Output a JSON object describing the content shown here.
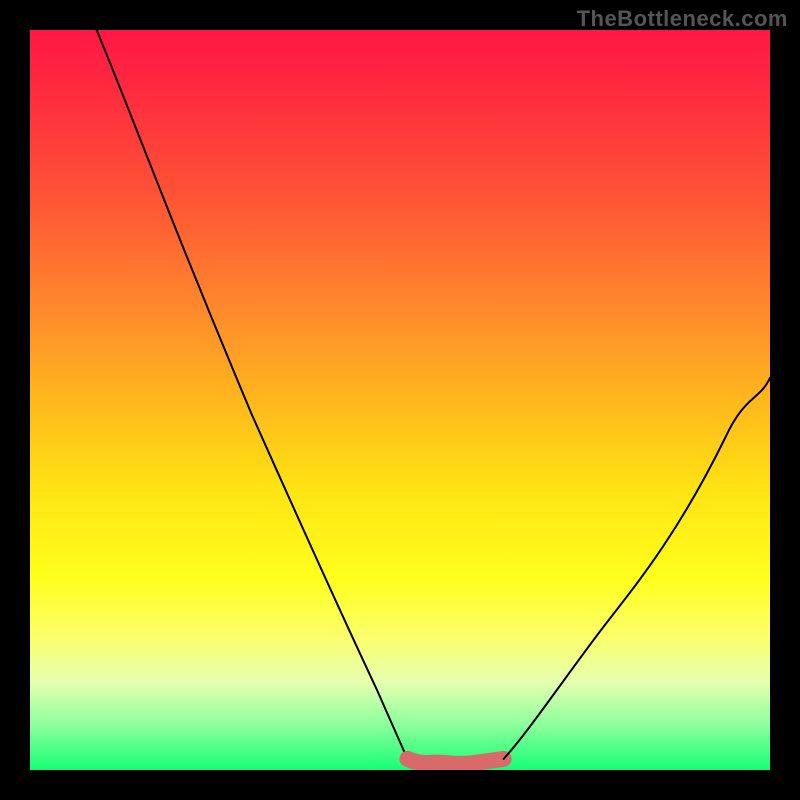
{
  "watermark": "TheBottleneck.com",
  "chart_data": {
    "type": "line",
    "title": "",
    "xlabel": "",
    "ylabel": "",
    "xlim": [
      0,
      100
    ],
    "ylim": [
      0,
      100
    ],
    "grid": false,
    "legend": false,
    "background_gradient": {
      "direction": "top-to-bottom",
      "stops": [
        {
          "pos": 0,
          "color": "#ff1745"
        },
        {
          "pos": 23,
          "color": "#ff5535"
        },
        {
          "pos": 50,
          "color": "#ffb71c"
        },
        {
          "pos": 74,
          "color": "#ffff1c"
        },
        {
          "pos": 94,
          "color": "#8bff9c"
        },
        {
          "pos": 100,
          "color": "#14ff73"
        }
      ]
    },
    "series": [
      {
        "name": "curve-left",
        "style": "thin-black",
        "x": [
          9,
          15,
          22,
          30,
          37,
          42,
          47,
          51
        ],
        "y": [
          100,
          85,
          68,
          48,
          30,
          17,
          7,
          1.5
        ]
      },
      {
        "name": "valley-floor",
        "style": "thick-pink",
        "x": [
          51,
          55,
          60,
          64
        ],
        "y": [
          1.5,
          0.8,
          0.8,
          1.5
        ]
      },
      {
        "name": "curve-right",
        "style": "thin-black",
        "x": [
          64,
          70,
          78,
          86,
          94,
          100
        ],
        "y": [
          1.5,
          8,
          20,
          33,
          45,
          53
        ]
      }
    ],
    "note": "Chart has no visible axis ticks, labels, or numeric values in the image. x/y values are normalized 0–100 estimates of the curve shape read from pixel positions."
  }
}
